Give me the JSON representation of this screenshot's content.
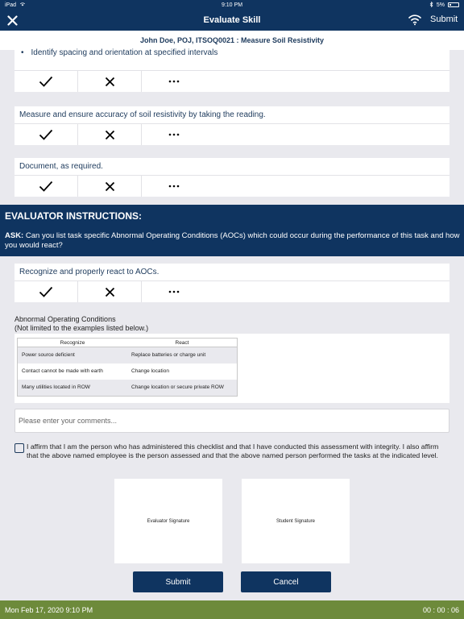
{
  "status_bar": {
    "device": "iPad",
    "time": "9:10 PM",
    "battery": "5%"
  },
  "nav": {
    "title": "Evaluate Skill",
    "submit_label": "Submit",
    "close_icon": "close-icon",
    "wifi_icon": "wifi-icon"
  },
  "subheader": "John Doe, POJ, ITSOQ0021 : Measure Soil Resistivity",
  "tasks": [
    {
      "text": "Identify spacing and orientation at specified intervals"
    },
    {
      "text": "Measure and ensure accuracy of soil resistivity by taking the reading."
    },
    {
      "text": "Document, as required."
    }
  ],
  "evaluator": {
    "heading": "EVALUATOR INSTRUCTIONS:",
    "ask_label": "ASK:",
    "ask_text": "Can you list task specific Abnormal Operating Conditions (AOCs) which could occur during the performance of this task and how you would react?"
  },
  "aoc_task": {
    "text": "Recognize and properly react to AOCs."
  },
  "aoc_section": {
    "title": "Abnormal Operating Conditions",
    "subtitle": "(Not limited to the examples listed below.)",
    "columns": [
      "Recognize",
      "React"
    ],
    "rows": [
      [
        "Power source deficient",
        "Replace batteries or charge unit"
      ],
      [
        "Contact cannot be made with earth",
        "Change location"
      ],
      [
        "Many utilities located in ROW",
        "Change location or secure private ROW"
      ]
    ]
  },
  "comments": {
    "placeholder": "Please enter your comments..."
  },
  "affirmation": "I affirm that I am the person who has administered this checklist and that I have conducted this assessment with integrity. I also affirm that the above named employee is the person assessed and that the above named person performed the tasks at the indicated level.",
  "signatures": {
    "evaluator": "Evaluator Signature",
    "student": "Student Signature"
  },
  "buttons": {
    "submit": "Submit",
    "cancel": "Cancel"
  },
  "footer": {
    "datetime": "Mon Feb 17, 2020 9:10 PM",
    "timer": "00 : 00 : 06"
  }
}
